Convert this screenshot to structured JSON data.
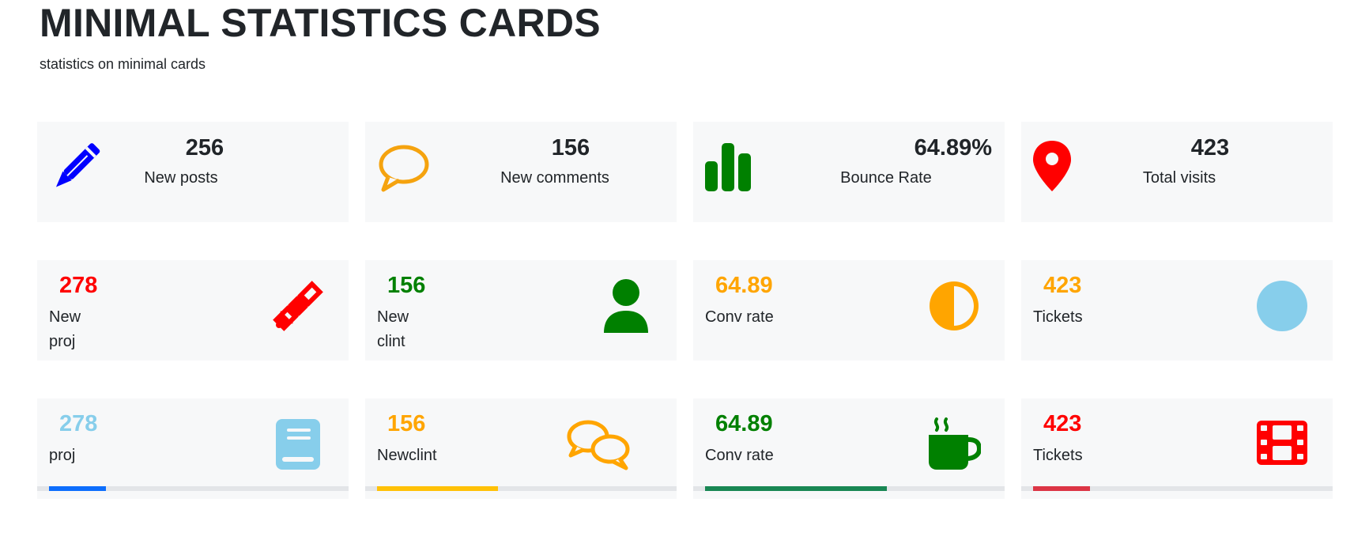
{
  "header": {
    "title": "MINIMAL STATISTICS CARDS",
    "subtitle": "statistics on minimal cards"
  },
  "row1": [
    {
      "value": "256",
      "label": "New posts",
      "icon": "pencil-icon",
      "color": "#0000ff"
    },
    {
      "value": "156",
      "label": "New comments",
      "icon": "speech-bubble-icon",
      "color": "#f5a30f"
    },
    {
      "value": "64.89%",
      "label": "Bounce Rate",
      "icon": "bar-chart-icon",
      "color": "#008000"
    },
    {
      "value": "423",
      "label": "Total visits",
      "icon": "map-pin-icon",
      "color": "#ff0000"
    }
  ],
  "row2": [
    {
      "value": "278",
      "label": "New\nproj",
      "icon": "satellite-icon",
      "color": "#ff0000",
      "value_color": "#ff0000"
    },
    {
      "value": "156",
      "label": "New\nclint",
      "icon": "user-icon",
      "color": "#008000",
      "value_color": "#008000"
    },
    {
      "value": "64.89",
      "label": "Conv rate",
      "icon": "half-circle-icon",
      "color": "#ffa500",
      "value_color": "#ffa500"
    },
    {
      "value": "423",
      "label": "Tickets",
      "icon": "circle-icon",
      "color": "#87ceeb",
      "value_color": "#ffa500"
    }
  ],
  "row3": [
    {
      "value": "278",
      "label": "proj",
      "icon": "book-icon",
      "color": "#87ceeb",
      "value_color": "#87ceeb",
      "progress": 0.17,
      "bar_color": "#0d6efd"
    },
    {
      "value": "156",
      "label": "Newclint",
      "icon": "chat-bubbles-icon",
      "color": "#ffa500",
      "value_color": "#ffa500",
      "progress": 0.36,
      "bar_color": "#ffc107"
    },
    {
      "value": "64.89",
      "label": "Conv rate",
      "icon": "coffee-cup-icon",
      "color": "#008000",
      "value_color": "#008000",
      "progress": 0.54,
      "bar_color": "#198754"
    },
    {
      "value": "423",
      "label": "Tickets",
      "icon": "film-icon",
      "color": "#ff0000",
      "value_color": "#ff0000",
      "progress": 0.17,
      "bar_color": "#dc3545"
    }
  ]
}
